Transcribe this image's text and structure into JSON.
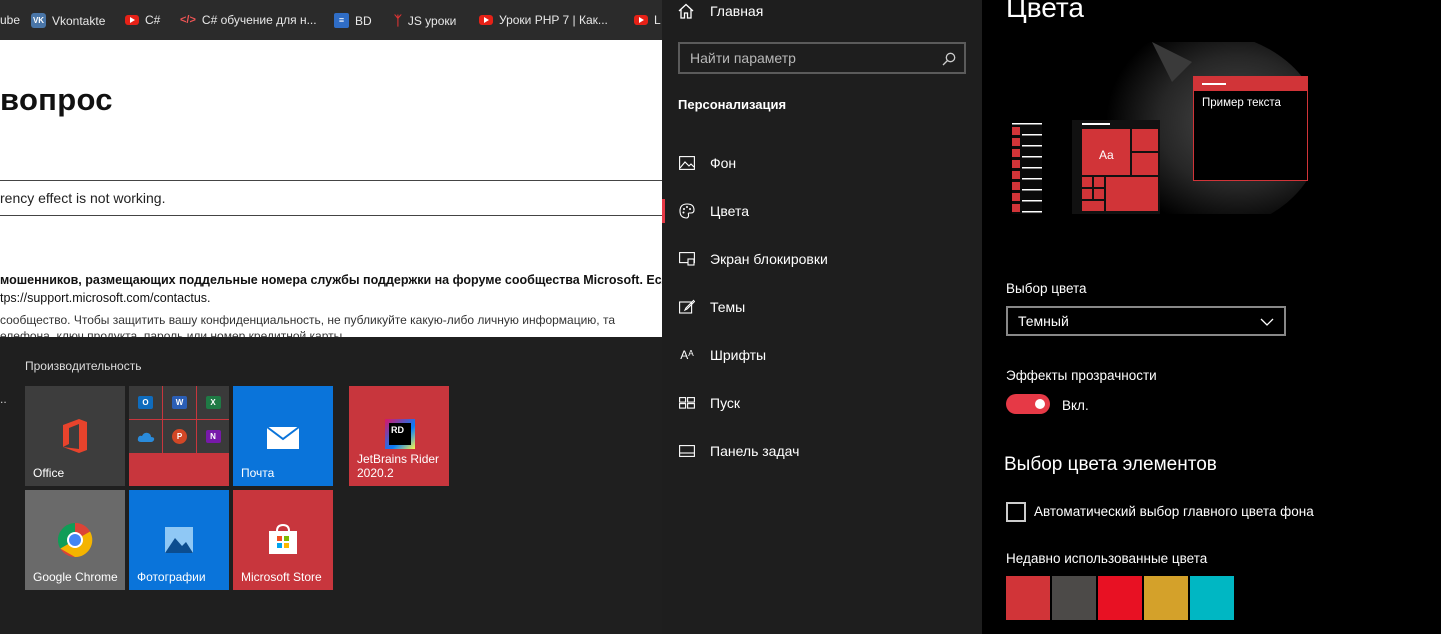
{
  "browser": {
    "bookmarks": [
      {
        "label": "ube",
        "icon": "none"
      },
      {
        "label": "Vkontakte",
        "icon": "vk-icon"
      },
      {
        "label": "C#",
        "icon": "youtube-icon"
      },
      {
        "label": "C# обучение для н...",
        "icon": "code-icon"
      },
      {
        "label": "BD",
        "icon": "bd-icon"
      },
      {
        "label": "JS уроки",
        "icon": "js-icon"
      },
      {
        "label": "Уроки PHP 7 | Как...",
        "icon": "youtube-icon"
      },
      {
        "label": "L",
        "icon": "youtube-icon"
      }
    ],
    "title": "вопрос",
    "question": "rency effect is not working.",
    "notice_bold": "мошенников, размещающих поддельные номера службы поддержки на форуме сообщества Microsoft. Есл",
    "notice_link": "tps://support.microsoft.com/contactus.",
    "notice_line2": "сообщество. Чтобы защитить вашу конфиденциальность, не публикуйте какую-либо личную информацию, та",
    "notice_line3": "елефона, ключ продукта, пароль или номер кредитной карты"
  },
  "start_menu": {
    "dots": "..",
    "group_title": "Производительность",
    "tiles": {
      "office": "Office",
      "mail": "Почта",
      "rider": "JetBrains Rider 2020.2",
      "chrome": "Google Chrome",
      "photos": "Фотографии",
      "store": "Microsoft Store"
    },
    "mini_tiles": {
      "outlook": "O",
      "word": "W",
      "excel": "X",
      "powerpoint": "P",
      "onenote": "N",
      "rider_icon": "RD"
    }
  },
  "settings_nav": {
    "home": "Главная",
    "search_placeholder": "Найти параметр",
    "section_title": "Персонализация",
    "items": [
      {
        "label": "Фон",
        "icon": "image-icon"
      },
      {
        "label": "Цвета",
        "icon": "palette-icon",
        "active": true
      },
      {
        "label": "Экран блокировки",
        "icon": "lock-screen-icon"
      },
      {
        "label": "Темы",
        "icon": "brush-icon"
      },
      {
        "label": "Шрифты",
        "icon": "font-icon"
      },
      {
        "label": "Пуск",
        "icon": "start-icon"
      },
      {
        "label": "Панель задач",
        "icon": "taskbar-icon"
      }
    ]
  },
  "content": {
    "title": "Цвета",
    "preview": {
      "sample_text": "Пример текста",
      "tile_text": "Aa"
    },
    "choose_color_label": "Выбор цвета",
    "choose_color_value": "Темный",
    "transparency_label": "Эффекты прозрачности",
    "transparency_state": "Вкл.",
    "transparency_on": true,
    "accent_header": "Выбор цвета элементов",
    "auto_accent_label": "Автоматический выбор главного цвета фона",
    "auto_accent_checked": false,
    "recent_colors_label": "Недавно использованные цвета",
    "recent_colors": [
      "#d13438",
      "#4c4a48",
      "#e81123",
      "#d4a12a",
      "#00b7c3"
    ]
  },
  "colors": {
    "accent": "#e63946",
    "nav_bg": "#1e1e1e",
    "content_bg": "#000000"
  }
}
